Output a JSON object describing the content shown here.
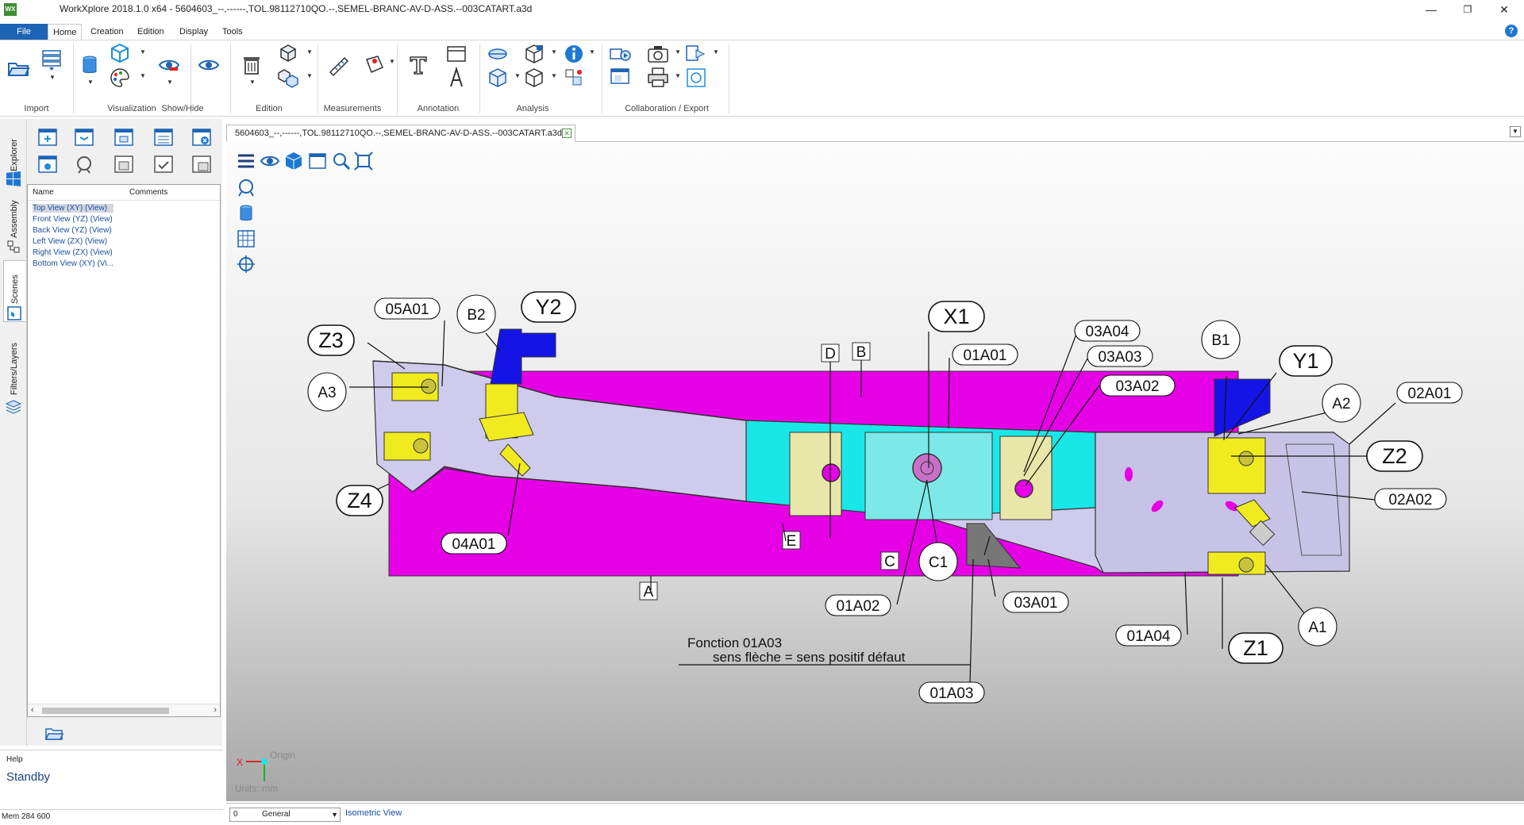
{
  "app": {
    "logo": "WX",
    "title": "WorkXplore 2018.1.0 x64 - 5604603_--,------,TOL.98112710QO.--,SEMEL-BRANC-AV-D-ASS.--003CATART.a3d",
    "window_controls": {
      "minimize": "—",
      "maximize": "❐",
      "close": "✕"
    }
  },
  "menu": {
    "file": "File",
    "tabs": [
      "Home",
      "Creation",
      "Edition",
      "Display",
      "Tools"
    ],
    "active_tab": "Home",
    "help": "?"
  },
  "ribbon": {
    "groups": [
      {
        "label": "Import",
        "icons": [
          "open-folder-icon",
          "import-list-icon"
        ]
      },
      {
        "label": "Visualization",
        "icons": [
          "cylinder-icon",
          "cube-wire-icon",
          "palette-icon"
        ]
      },
      {
        "label": "Show/Hide",
        "icons": [
          "eye-hide-icon",
          "eye-show-icon"
        ]
      },
      {
        "label": "Edition",
        "icons": [
          "trash-icon",
          "part-icon",
          "parts-icon"
        ]
      },
      {
        "label": "Measurements",
        "icons": [
          "caliper-icon",
          "measure-point-icon"
        ]
      },
      {
        "label": "Annotation",
        "icons": [
          "text-icon",
          "frame-icon",
          "text-3d-icon"
        ]
      },
      {
        "label": "Analysis",
        "icons": [
          "section-icon",
          "box-section-icon",
          "info-icon",
          "box-icon",
          "box-analysis-icon",
          "cubes-icon"
        ]
      },
      {
        "label": "Collaboration / Export",
        "icons": [
          "share-3d-icon",
          "camera-icon",
          "export-icon",
          "screen-icon",
          "print-icon",
          "export-web-icon"
        ]
      }
    ]
  },
  "document": {
    "tab_label": "5604603_--,------,TOL.98112710QO.--,SEMEL-BRANC-AV-D-ASS.--003CATART.a3d"
  },
  "left_tabs": [
    "Explorer",
    "Assembly",
    "Scenes",
    "Filters/Layers"
  ],
  "scenes": {
    "columns": [
      "Name",
      "Comments"
    ],
    "rows": [
      "Top View (XY) (View)",
      "Front View (YZ) (View)",
      "Back View (YZ) (View)",
      "Left View (ZX) (View)",
      "Right View (ZX) (View)",
      "Bottom View (XY) (Vi..."
    ],
    "selected_index": 0,
    "scroll_left": "‹",
    "scroll_right": "›"
  },
  "help": {
    "title": "Help",
    "status": "Standby"
  },
  "memory": "Mem 284 600",
  "viewport": {
    "axis": {
      "origin": "Origin",
      "units": "Units: mm",
      "x": "X"
    },
    "labels": {
      "Z3": "Z3",
      "Z4": "Z4",
      "Z2": "Z2",
      "Z1": "Z1",
      "Y2": "Y2",
      "Y1": "Y1",
      "X1": "X1",
      "05A01": "05A01",
      "B2": "B2",
      "A3": "A3",
      "04A01": "04A01",
      "D": "D",
      "B": "B",
      "E": "E",
      "A": "A",
      "C": "C",
      "C1": "C1",
      "01A01": "01A01",
      "01A02": "01A02",
      "01A03": "01A03",
      "01A04": "01A04",
      "03A04": "03A04",
      "03A03": "03A03",
      "03A02": "03A02",
      "03A01": "03A01",
      "B1": "B1",
      "A2": "A2",
      "A1": "A1",
      "02A01": "02A01",
      "02A02": "02A02"
    },
    "note_line1": "Fonction   01A03",
    "note_line2": "sens flèche = sens positif défaut",
    "colors": {
      "magenta": "#e600e6",
      "cyan": "#19e6e6",
      "yellow": "#f0eb1e",
      "blue": "#1414e6",
      "lavender": "#c7c3e6"
    }
  },
  "status": {
    "layer_number": "0",
    "layer_name": "General",
    "view_name": "Isometric View"
  }
}
